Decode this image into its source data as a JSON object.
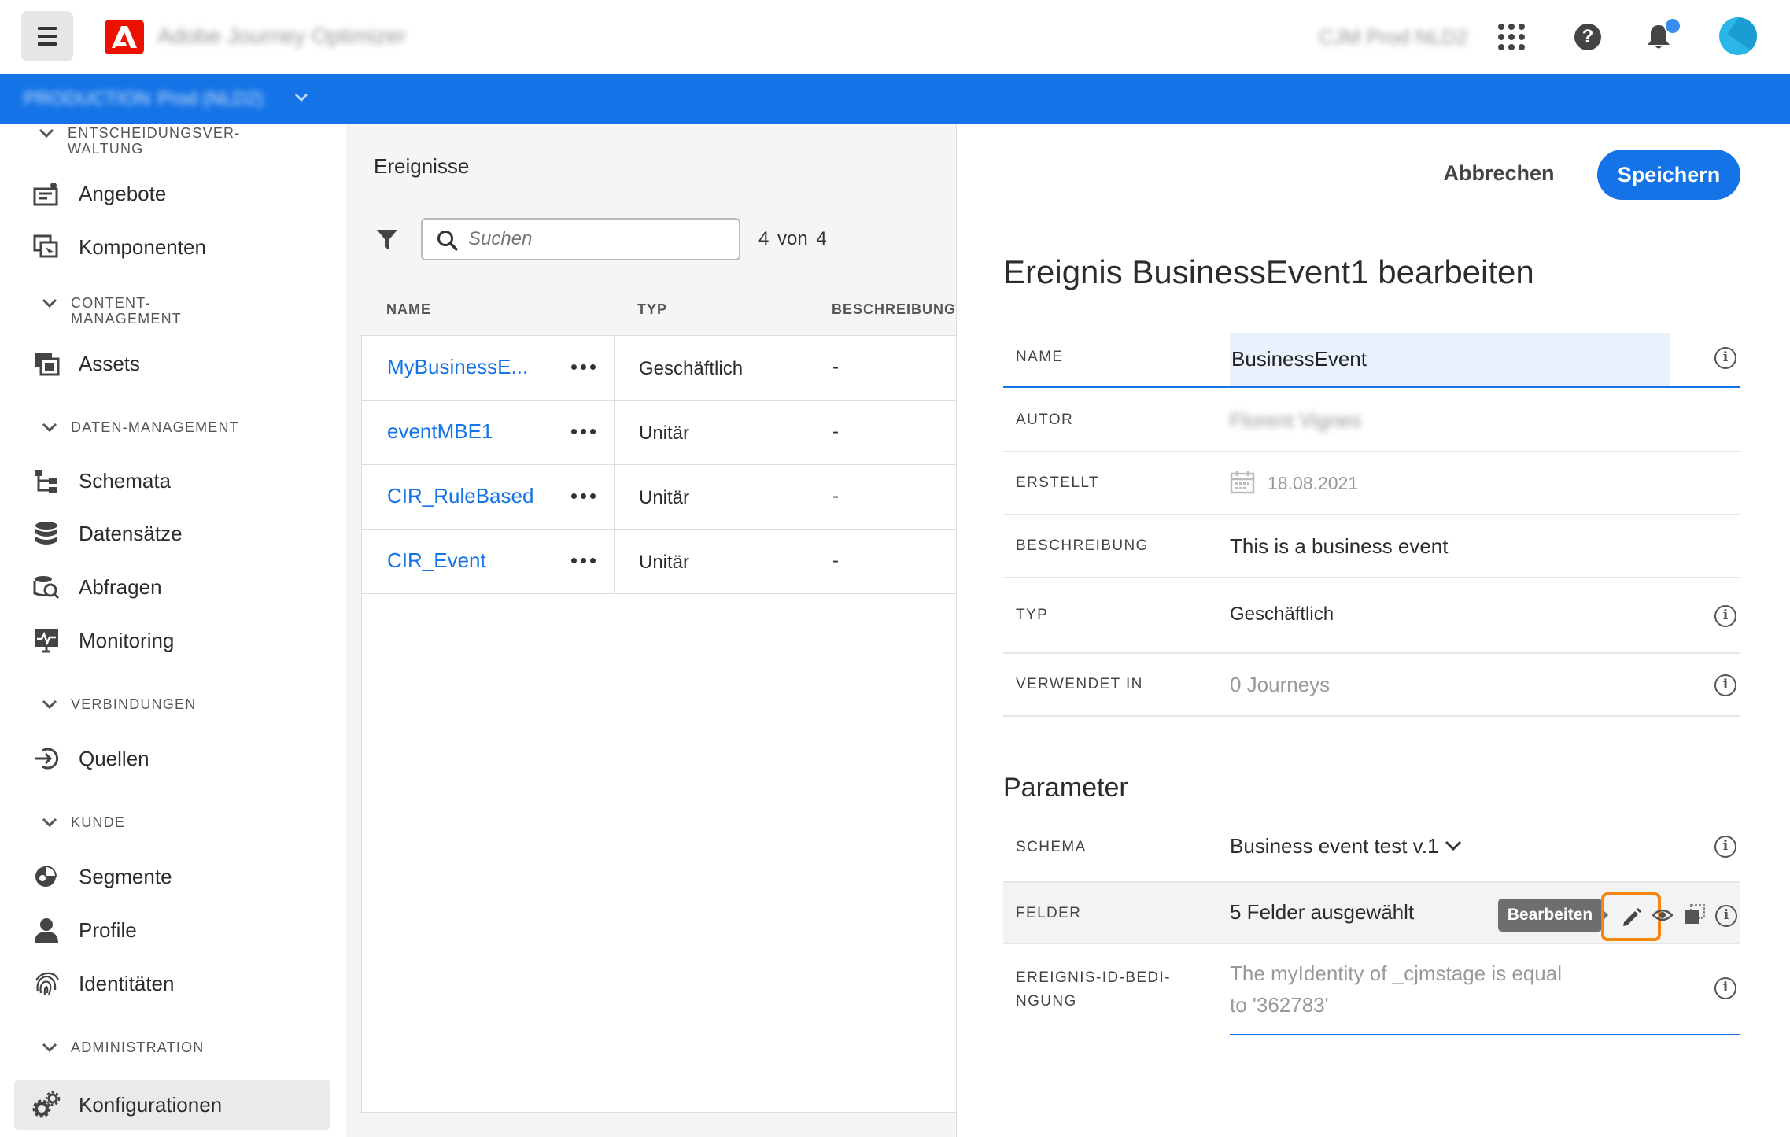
{
  "topbar": {
    "menu_icon": "hamburger-icon",
    "logo_icon": "adobe-logo",
    "app_title": "Adobe Journey Optimizer",
    "org_name": "CJM Prod NLD2"
  },
  "bluebar": {
    "sandbox_label": "PRODUCTION",
    "sandbox_name": "Prod (NLD2)"
  },
  "sidebar": {
    "sections": [
      {
        "header": "ENTSCHEIDUNGSVER-\nWALTUNG",
        "items": [
          "Angebote",
          "Komponenten"
        ]
      },
      {
        "header": "CONTENT-\nMANAGEMENT",
        "items": [
          "Assets"
        ]
      },
      {
        "header": "DATEN-MANAGEMENT",
        "items": [
          "Schemata",
          "Datensätze",
          "Abfragen",
          "Monitoring"
        ]
      },
      {
        "header": "VERBINDUNGEN",
        "items": [
          "Quellen"
        ]
      },
      {
        "header": "KUNDE",
        "items": [
          "Segmente",
          "Profile",
          "Identitäten"
        ]
      },
      {
        "header": "ADMINISTRATION",
        "items": [
          "Konfigurationen"
        ]
      }
    ],
    "active_item": "Konfigurationen"
  },
  "events": {
    "title": "Ereignisse",
    "search_placeholder": "Suchen",
    "count": "4 von 4",
    "columns": [
      "NAME",
      "TYP",
      "BESCHREIBUNG"
    ],
    "rows": [
      {
        "name": "MyBusinessE...",
        "type": "Geschäftlich",
        "description": "-"
      },
      {
        "name": "eventMBE1",
        "type": "Unitär",
        "description": "-"
      },
      {
        "name": "CIR_RuleBased",
        "type": "Unitär",
        "description": "-"
      },
      {
        "name": "CIR_Event",
        "type": "Unitär",
        "description": "-"
      }
    ]
  },
  "edit": {
    "cancel_label": "Abbrechen",
    "save_label": "Speichern",
    "title": "Ereignis BusinessEvent1 bearbeiten",
    "fields": {
      "name_label": "NAME",
      "name_value": "BusinessEvent",
      "author_label": "AUTOR",
      "author_value": "Florent Vignes",
      "created_label": "ERSTELLT",
      "created_value": "18.08.2021",
      "description_label": "BESCHREIBUNG",
      "description_value": "This is a business event",
      "type_label": "TYP",
      "type_value": "Geschäftlich",
      "used_in_label": "VERWENDET IN",
      "used_in_value": "0 Journeys"
    },
    "parameters": {
      "title": "Parameter",
      "schema_label": "SCHEMA",
      "schema_value": "Business event test v.1",
      "fields_label": "FELDER",
      "fields_value": "5 Felder ausgewählt",
      "tooltip": "Bearbeiten",
      "event_id_label_1": "EREIGNIS-ID-BEDI-",
      "event_id_label_2": "NGUNG",
      "event_id_value_1": "The myIdentity of _cjmstage is equal",
      "event_id_value_2": "to '362783'"
    }
  },
  "colors": {
    "accent": "#1473e6",
    "highlight": "#f68511",
    "adobe_red": "#eb1000"
  }
}
